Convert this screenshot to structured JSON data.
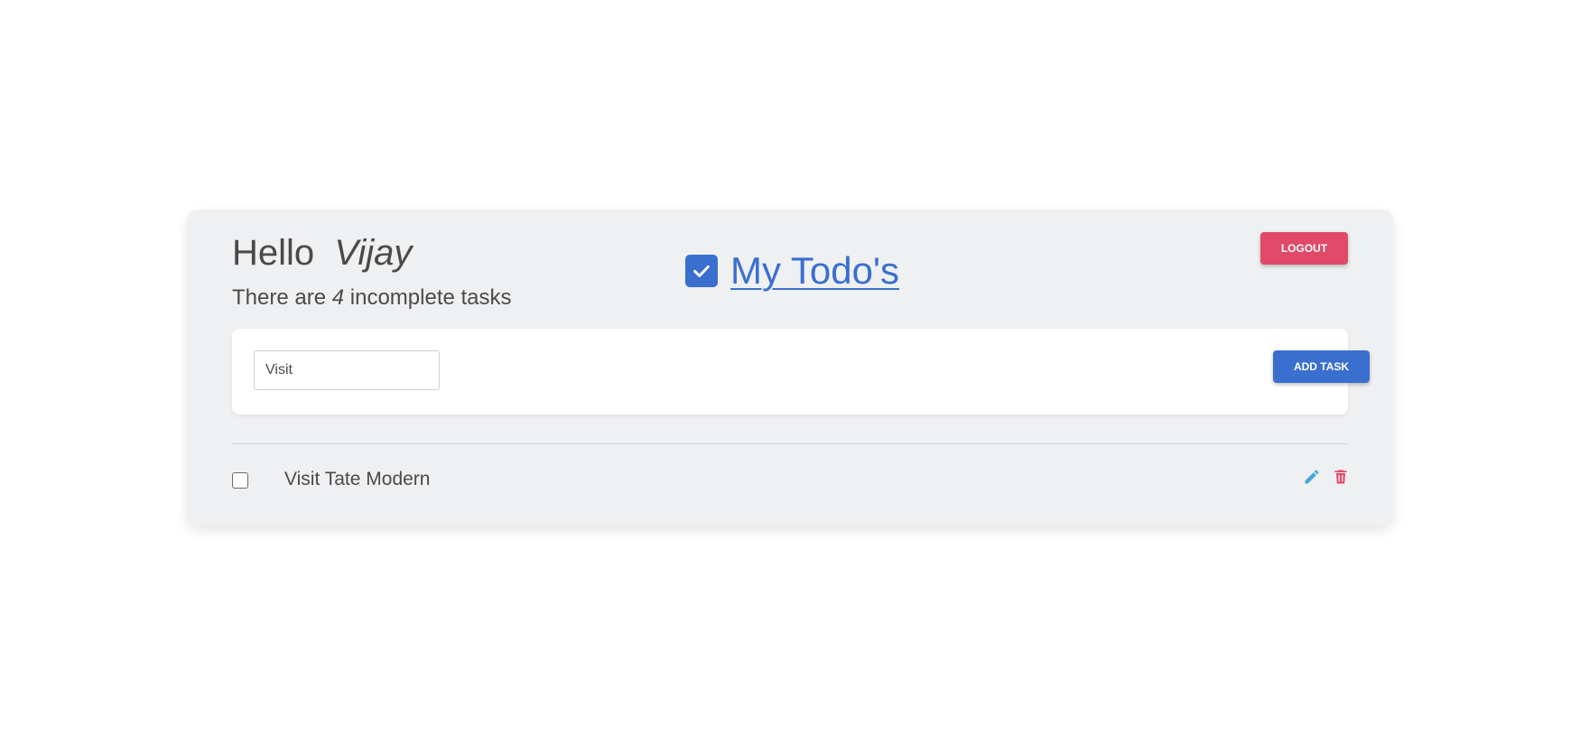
{
  "header": {
    "greeting_prefix": "Hello",
    "user_name": "Vijay",
    "incomplete_prefix": "There are",
    "incomplete_count": "4",
    "incomplete_suffix": "incomplete tasks"
  },
  "brand": {
    "icon": "check-square-icon",
    "title": "My Todo's"
  },
  "actions": {
    "logout_label": "LOGOUT",
    "add_task_label": "ADD TASK"
  },
  "task_input": {
    "value": "Visit"
  },
  "todos": [
    {
      "text": "Visit Tate Modern",
      "completed": false,
      "edit_icon": "pencil-icon",
      "delete_icon": "trash-icon"
    }
  ],
  "colors": {
    "accent": "#3a6fd0",
    "danger": "#e04a68",
    "edit": "#4aa8d8",
    "card_bg": "#eff0f2",
    "text": "#4a4a4a"
  }
}
